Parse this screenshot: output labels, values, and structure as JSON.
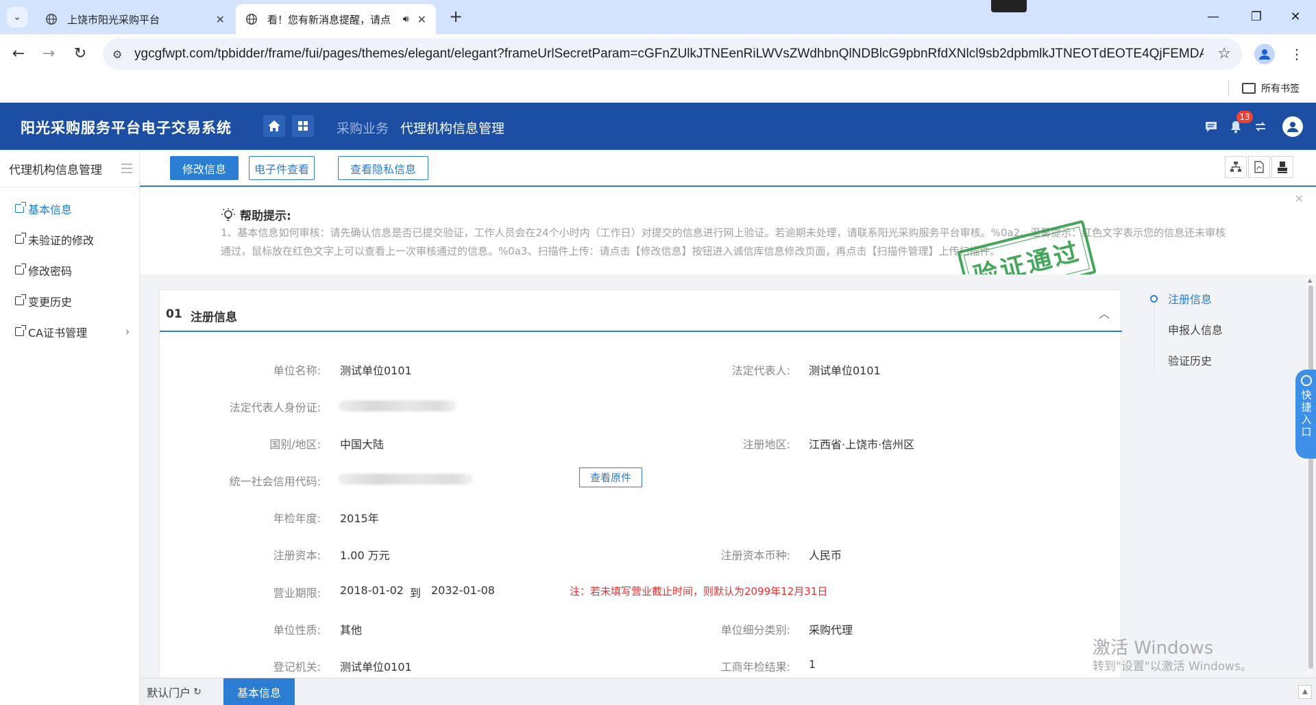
{
  "browser": {
    "tabs": [
      {
        "title": "上饶市阳光采购平台"
      },
      {
        "title": "看！您有新消息提醒，请点"
      }
    ],
    "url": "ygcgfwpt.com/tpbidder/frame/fui/pages/themes/elegant/elegant?frameUrlSecretParam=cGFnZUlkJTNEenRiLWVsZWdhbnQlNDBlcG9pbnRfdXNlcl9sb2dpbmlkJTNEOTdEOTE4QjFEMDA2...",
    "bookmarks_label": "所有书签"
  },
  "header": {
    "app_title": "阳光采购服务平台电子交易系统",
    "nav_parent": "采购业务",
    "nav_current": "代理机构信息管理",
    "notification_count": "13"
  },
  "sidebar": {
    "title": "代理机构信息管理",
    "items": [
      {
        "label": "基本信息"
      },
      {
        "label": "未验证的修改"
      },
      {
        "label": "修改密码"
      },
      {
        "label": "变更历史"
      },
      {
        "label": "CA证书管理"
      }
    ]
  },
  "toolbar": {
    "edit_label": "修改信息",
    "efile_label": "电子件查看",
    "privacy_label": "查看隐私信息"
  },
  "help": {
    "title": "帮助提示:",
    "text": "1、基本信息如何审核：请先确认信息是否已提交验证，工作人员会在24个小时内（工作日）对提交的信息进行网上验证。若逾期未处理，请联系阳光采购服务平台审核。%0a2、温馨提示：红色文字表示您的信息还未审核通过，鼠标放在红色文字上可以查看上一次审核通过的信息。%0a3、扫描件上传：请点击【修改信息】按钮进入诚信库信息修改页面，再点击【扫描件管理】上传扫描件。"
  },
  "stamp_text": "验证通过",
  "section": {
    "number": "01",
    "title": "注册信息"
  },
  "fields": {
    "unit_name_label": "单位名称:",
    "unit_name": "测试单位0101",
    "legal_rep_label": "法定代表人:",
    "legal_rep": "测试单位0101",
    "legal_id_label": "法定代表人身份证:",
    "country_label": "国别/地区:",
    "country": "中国大陆",
    "reg_region_label": "注册地区:",
    "reg_region": "江西省·上饶市·信州区",
    "credit_code_label": "统一社会信用代码:",
    "view_original": "查看原件",
    "inspect_year_label": "年检年度:",
    "inspect_year": "2015年",
    "reg_capital_label": "注册资本:",
    "reg_capital": "1.00 万元",
    "currency_label": "注册资本币种:",
    "currency": "人民币",
    "biz_term_label": "营业期限:",
    "biz_start": "2018-01-02",
    "biz_to": "到",
    "biz_end": "2032-01-08",
    "biz_note": "注：若未填写营业截止时间，则默认为2099年12月31日",
    "unit_nature_label": "单位性质:",
    "unit_nature": "其他",
    "unit_category_label": "单位细分类别:",
    "unit_category": "采购代理",
    "reg_authority_label": "登记机关:",
    "reg_authority": "测试单位0101",
    "annual_result_label": "工商年检结果:",
    "annual_result": "1"
  },
  "anchor_nav": [
    {
      "label": "注册信息"
    },
    {
      "label": "申报人信息"
    },
    {
      "label": "验证历史"
    }
  ],
  "quick_entry": "快捷入口",
  "watermark": {
    "line1": "激活 Windows",
    "line2": "转到\"设置\"以激活 Windows。"
  },
  "bottom_tabs": {
    "default_portal": "默认门户",
    "basic_info": "基本信息"
  },
  "colors": {
    "header_bg": "#1c4fa3",
    "accent": "#2b7cd3",
    "stamp": "#2c9a45",
    "warning": "#ef2d2d"
  }
}
